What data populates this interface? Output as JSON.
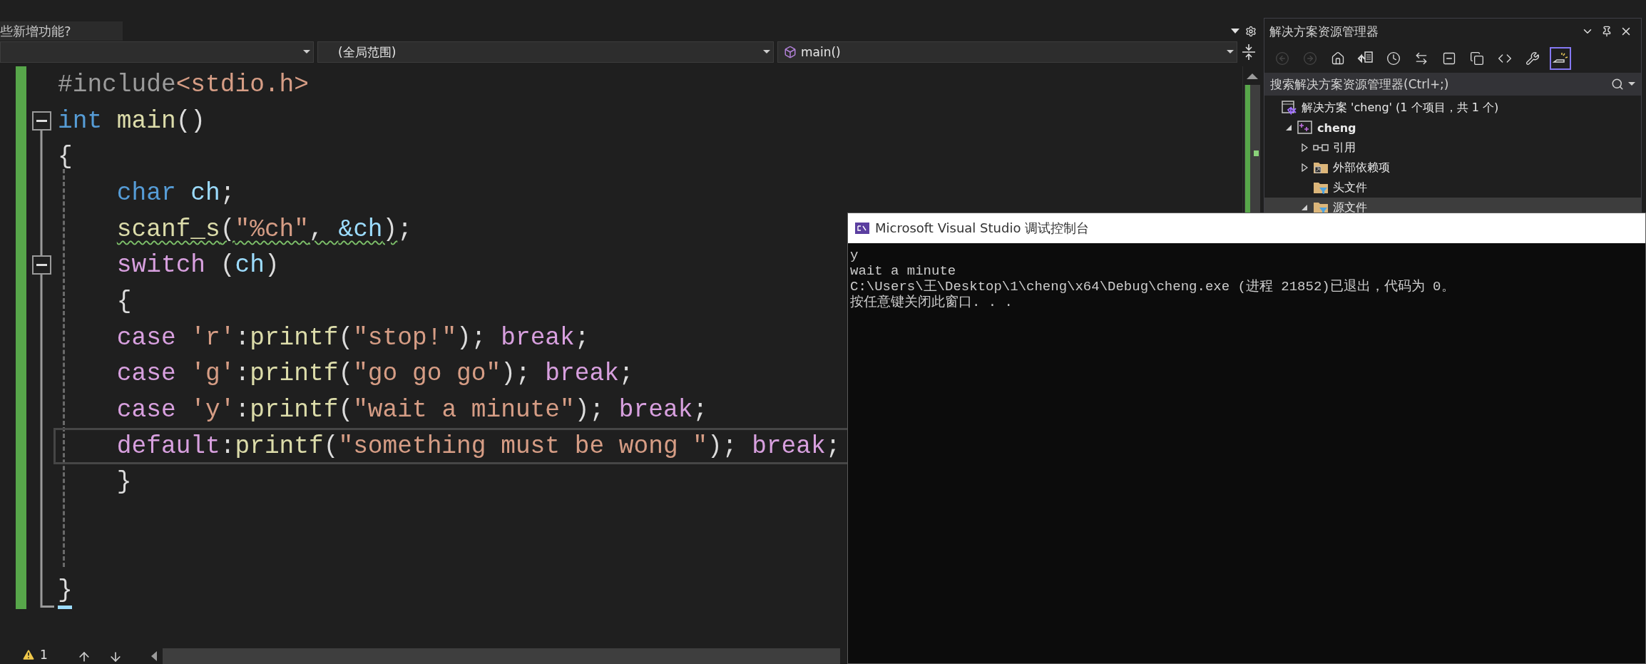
{
  "editor": {
    "info_tag": "些新增功能?",
    "nav": {
      "scope": "(全局范围)",
      "member": "main()"
    },
    "lines": [
      {
        "current": false,
        "tokens": [
          {
            "kind": "preproc",
            "text": "#include"
          },
          {
            "kind": "string",
            "text": "<stdio.h>"
          }
        ]
      },
      {
        "current": false,
        "expanded": true,
        "tokens": [
          {
            "kind": "keyword",
            "text": "int "
          },
          {
            "kind": "func",
            "text": "main"
          },
          {
            "kind": "plain",
            "text": "()"
          }
        ]
      },
      {
        "current": false,
        "tokens": [
          {
            "kind": "plain",
            "text": "{"
          }
        ]
      },
      {
        "current": false,
        "tokens": [
          {
            "kind": "keyword",
            "text": "    char "
          },
          {
            "kind": "var",
            "text": "ch"
          },
          {
            "kind": "plain",
            "text": ";"
          }
        ]
      },
      {
        "current": false,
        "tokens": [
          {
            "kind": "func",
            "text": "    scanf_s",
            "squiggle": true
          },
          {
            "kind": "plain",
            "text": "(",
            "squiggle": true
          },
          {
            "kind": "string",
            "text": "\"%ch\"",
            "squiggle": true
          },
          {
            "kind": "plain",
            "text": ", ",
            "squiggle": true
          },
          {
            "kind": "var",
            "text": "&ch",
            "squiggle": true
          },
          {
            "kind": "plain",
            "text": ")",
            "squiggle": true
          },
          {
            "kind": "plain",
            "text": ";",
            "squiggle": false
          }
        ]
      },
      {
        "current": false,
        "expanded": true,
        "tokens": [
          {
            "kind": "control",
            "text": "    switch"
          },
          {
            "kind": "plain",
            "text": " ("
          },
          {
            "kind": "var",
            "text": "ch"
          },
          {
            "kind": "plain",
            "text": ")"
          }
        ]
      },
      {
        "current": false,
        "tokens": [
          {
            "kind": "plain",
            "text": "    {"
          }
        ]
      },
      {
        "current": false,
        "tokens": [
          {
            "kind": "control",
            "text": "    case "
          },
          {
            "kind": "string",
            "text": "'r'"
          },
          {
            "kind": "plain",
            "text": ":"
          },
          {
            "kind": "func",
            "text": "printf"
          },
          {
            "kind": "plain",
            "text": "("
          },
          {
            "kind": "string",
            "text": "\"stop!\""
          },
          {
            "kind": "plain",
            "text": "); "
          },
          {
            "kind": "control",
            "text": "break"
          },
          {
            "kind": "plain",
            "text": ";"
          }
        ]
      },
      {
        "current": false,
        "tokens": [
          {
            "kind": "control",
            "text": "    case "
          },
          {
            "kind": "string",
            "text": "'g'"
          },
          {
            "kind": "plain",
            "text": ":"
          },
          {
            "kind": "func",
            "text": "printf"
          },
          {
            "kind": "plain",
            "text": "("
          },
          {
            "kind": "string",
            "text": "\"go go go\""
          },
          {
            "kind": "plain",
            "text": "); "
          },
          {
            "kind": "control",
            "text": "break"
          },
          {
            "kind": "plain",
            "text": ";"
          }
        ]
      },
      {
        "current": false,
        "tokens": [
          {
            "kind": "control",
            "text": "    case "
          },
          {
            "kind": "string",
            "text": "'y'"
          },
          {
            "kind": "plain",
            "text": ":"
          },
          {
            "kind": "func",
            "text": "printf"
          },
          {
            "kind": "plain",
            "text": "("
          },
          {
            "kind": "string",
            "text": "\"wait a minute\""
          },
          {
            "kind": "plain",
            "text": "); "
          },
          {
            "kind": "control",
            "text": "break"
          },
          {
            "kind": "plain",
            "text": ";"
          }
        ]
      },
      {
        "current": true,
        "tokens": [
          {
            "kind": "control",
            "text": "    default"
          },
          {
            "kind": "plain",
            "text": ":"
          },
          {
            "kind": "func",
            "text": "printf"
          },
          {
            "kind": "plain",
            "text": "("
          },
          {
            "kind": "string",
            "text": "\"something must be wong \""
          },
          {
            "kind": "plain",
            "text": "); "
          },
          {
            "kind": "control",
            "text": "break"
          },
          {
            "kind": "plain",
            "text": ";"
          }
        ]
      },
      {
        "current": false,
        "tokens": [
          {
            "kind": "plain",
            "text": "    }"
          }
        ]
      },
      {
        "current": false
      },
      {
        "current": false
      },
      {
        "current": false,
        "tokens": [
          {
            "kind": "plain",
            "text": "}"
          }
        ]
      }
    ],
    "status": {
      "warnings": "1"
    }
  },
  "solution_explorer": {
    "title": "解决方案资源管理器",
    "toolbar": [
      {
        "kind": "back",
        "disabled": true,
        "selected": false
      },
      {
        "kind": "forward",
        "disabled": true,
        "selected": false
      },
      {
        "kind": "home",
        "disabled": false,
        "selected": false
      },
      {
        "kind": "switch-views",
        "disabled": false,
        "selected": false
      },
      {
        "kind": "pending",
        "disabled": false,
        "selected": false
      },
      {
        "kind": "sync",
        "disabled": false,
        "selected": false
      },
      {
        "kind": "collapse",
        "disabled": false,
        "selected": false
      },
      {
        "kind": "show-all",
        "disabled": false,
        "selected": false
      },
      {
        "kind": "code",
        "disabled": false,
        "selected": false
      },
      {
        "kind": "properties",
        "disabled": false,
        "selected": false
      },
      {
        "kind": "preview",
        "disabled": false,
        "selected": true
      }
    ],
    "search": {
      "placeholder": "搜索解决方案资源管理器(Ctrl+;)"
    },
    "tree": [
      {
        "kind": "solution",
        "label": "解决方案 'cheng' (1 个项目，共 1 个)",
        "selected": false,
        "children": [
          {
            "kind": "project",
            "label": "cheng",
            "selected": false,
            "expanded": true,
            "children": [
              {
                "kind": "references",
                "label": "引用",
                "selected": false,
                "expanded": false
              },
              {
                "kind": "external",
                "label": "外部依赖项",
                "selected": false,
                "expanded": false
              },
              {
                "kind": "filter",
                "label": "头文件",
                "selected": false
              },
              {
                "kind": "filter",
                "label": "源文件",
                "selected": true,
                "expanded": true
              }
            ]
          }
        ]
      }
    ]
  },
  "console": {
    "title": "Microsoft Visual Studio 调试控制台",
    "lines": [
      "y",
      "wait a minute",
      "C:\\Users\\王\\Desktop\\1\\cheng\\x64\\Debug\\cheng.exe (进程 21852)已退出，代码为 0。",
      "按任意键关闭此窗口. . ."
    ]
  }
}
